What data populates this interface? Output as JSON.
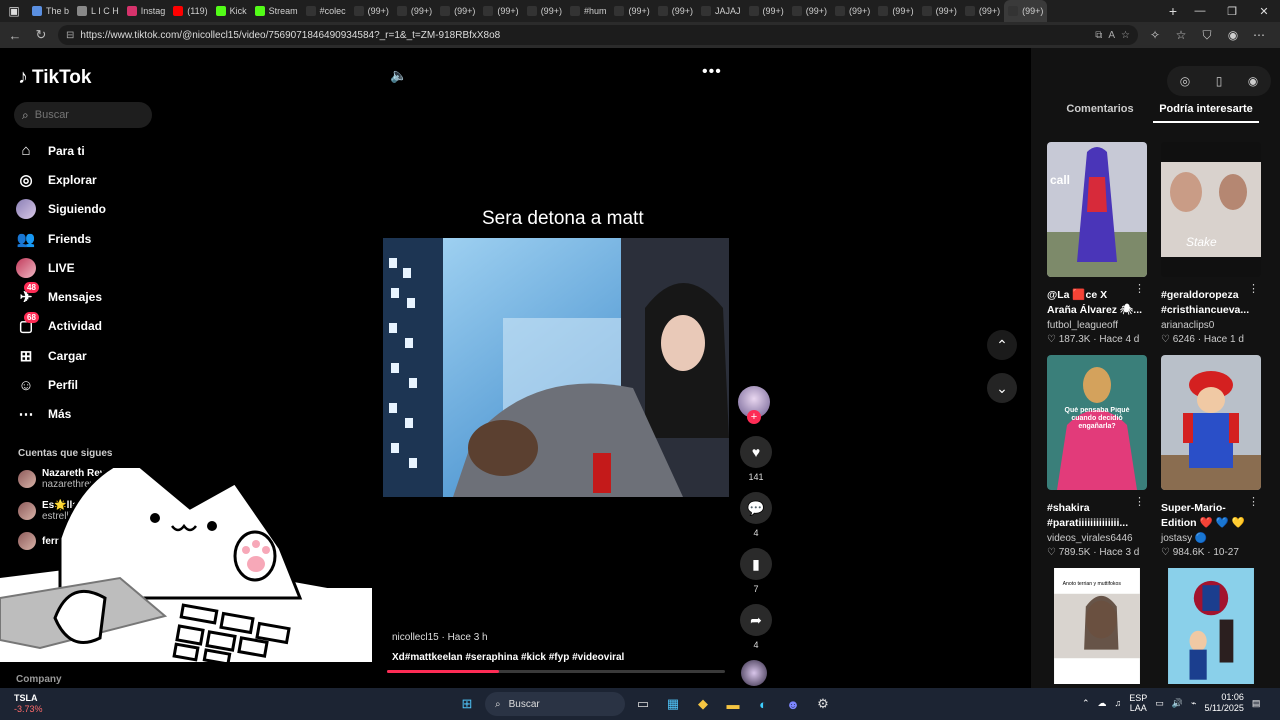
{
  "browser": {
    "tabs": [
      {
        "label": "The b",
        "color": "#5a8fe0"
      },
      {
        "label": "L I C H",
        "color": "#888888"
      },
      {
        "label": "Instag",
        "color": "#d6336c"
      },
      {
        "label": "(119)",
        "color": "#ff0000"
      },
      {
        "label": "Kick",
        "color": "#53fc18"
      },
      {
        "label": "Stream",
        "color": "#53fc18"
      },
      {
        "label": "#colec",
        "color": "#333333"
      },
      {
        "label": "(99+)",
        "color": "#333333"
      },
      {
        "label": "(99+)",
        "color": "#333333"
      },
      {
        "label": "(99+)",
        "color": "#333333"
      },
      {
        "label": "(99+)",
        "color": "#333333"
      },
      {
        "label": "(99+)",
        "color": "#333333"
      },
      {
        "label": "#hum",
        "color": "#333333"
      },
      {
        "label": "(99+)",
        "color": "#333333"
      },
      {
        "label": "(99+)",
        "color": "#333333"
      },
      {
        "label": "JAJAJ",
        "color": "#333333"
      },
      {
        "label": "(99+)",
        "color": "#333333"
      },
      {
        "label": "(99+)",
        "color": "#333333"
      },
      {
        "label": "(99+)",
        "color": "#333333"
      },
      {
        "label": "(99+)",
        "color": "#333333"
      },
      {
        "label": "(99+)",
        "color": "#333333"
      },
      {
        "label": "(99+)",
        "color": "#333333"
      },
      {
        "label": "(99+)",
        "color": "#333333"
      }
    ],
    "url": "https://www.tiktok.com/@nicollecl15/video/7569071846490934584?_r=1&_t=ZM-918RBfxX8o8"
  },
  "sidebar": {
    "logo": "TikTok",
    "search_placeholder": "Buscar",
    "nav": [
      {
        "label": "Para ti",
        "icon": "home-icon"
      },
      {
        "label": "Explorar",
        "icon": "compass-icon"
      },
      {
        "label": "Siguiendo",
        "icon": "avatar"
      },
      {
        "label": "Friends",
        "icon": "friends-icon"
      },
      {
        "label": "LIVE",
        "icon": "live-avatar"
      },
      {
        "label": "Mensajes",
        "icon": "message-icon",
        "badge": "48"
      },
      {
        "label": "Actividad",
        "icon": "activity-icon",
        "badge": "68"
      },
      {
        "label": "Cargar",
        "icon": "upload-icon"
      },
      {
        "label": "Perfil",
        "icon": "profile-icon"
      },
      {
        "label": "Más",
        "icon": "more-icon"
      }
    ],
    "following_title": "Cuentas que sigues",
    "following": [
      {
        "name": "Nazareth Reve",
        "handle": "nazarethreve"
      },
      {
        "name": "Es🌟lla💋",
        "handle": "estrellita.lm"
      },
      {
        "name": "fernand",
        "handle": ""
      }
    ],
    "company": "Company"
  },
  "video": {
    "caption": "Sera detona a matt",
    "author_line": "nicollecl15 · Hace 3 h",
    "tags": "Xd#mattkeelan #seraphina #kick #fyp #videoviral",
    "progress": 0.33,
    "likes": "141",
    "comments": "4",
    "saves": "7",
    "shares": "4"
  },
  "right_panel": {
    "tabs": [
      "Comentarios",
      "Podría interesarte"
    ],
    "active_tab": 1,
    "cards": [
      {
        "title1": "@La 🟥ce X",
        "title2": "Araña Álvarez 🕷...",
        "who": "futbol_leagueoff",
        "stats": "♡ 187.3K · Hace 4 d",
        "thumb_text": "call"
      },
      {
        "title1": "#geraldoropeza",
        "title2": "#cristhiancueva...",
        "who": "arianaclips0",
        "stats": "♡ 6246 · Hace 1 d",
        "thumb_text": "Stake"
      },
      {
        "title1": "#shakira",
        "title2": "#paratiiiiiiiiiiiiii...",
        "who": "videos_virales6446",
        "stats": "♡ 789.5K · Hace 3 d",
        "thumb_text": "Qué pensaba Piqué cuando decidió engañarla?"
      },
      {
        "title1": "Super-Mario-",
        "title2": "Edition ❤️ 💙 💛",
        "who": "jostasy 🔵",
        "stats": "♡ 984.6K · 10-27",
        "thumb_text": ""
      },
      {
        "title1": "",
        "title2": "",
        "who": "",
        "stats": "",
        "thumb_text": "Anoto terrian y muttifokos"
      },
      {
        "title1": "",
        "title2": "",
        "who": "",
        "stats": "",
        "thumb_text": ""
      }
    ]
  },
  "taskbar": {
    "ticker_symbol": "TSLA",
    "ticker_change": "-3.73%",
    "search_label": "Buscar",
    "lang1": "ESP",
    "lang2": "LAA",
    "time": "01:06",
    "date": "5/11/2025"
  },
  "colors": {
    "accent": "#fe2c55",
    "background": "#000000",
    "panel": "#121212"
  }
}
